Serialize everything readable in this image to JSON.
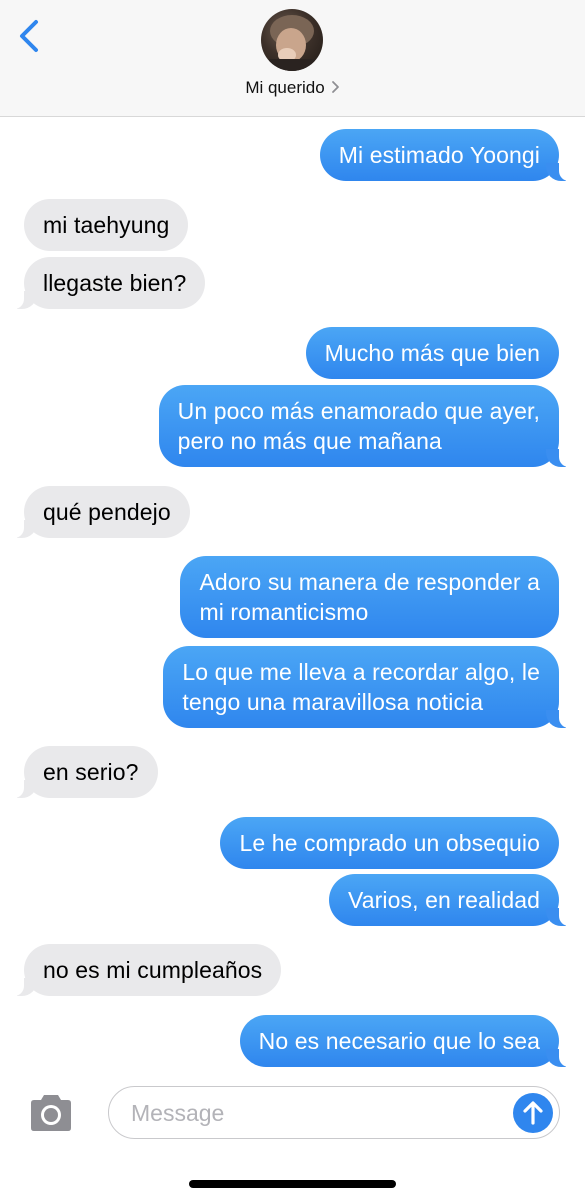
{
  "header": {
    "contact_name": "Mi querido",
    "icons": {
      "back": "chevron-left-icon",
      "name_chevron": "chevron-right-icon"
    }
  },
  "messages": [
    {
      "from": "me",
      "text": "Mi estimado Yoongi"
    },
    {
      "from": "them",
      "text": "mi taehyung"
    },
    {
      "from": "them",
      "text": "llegaste bien?"
    },
    {
      "from": "me",
      "text": "Mucho más que bien"
    },
    {
      "from": "me",
      "text": "Un poco más enamorado que ayer,\npero no más que mañana"
    },
    {
      "from": "them",
      "text": "qué pendejo"
    },
    {
      "from": "me",
      "text": "Adoro su manera de responder a\nmi romanticismo"
    },
    {
      "from": "me",
      "text": "Lo que me lleva a recordar algo, le\ntengo una maravillosa noticia"
    },
    {
      "from": "them",
      "text": "en serio?"
    },
    {
      "from": "me",
      "text": "Le he comprado un obsequio"
    },
    {
      "from": "me",
      "text": "Varios, en realidad"
    },
    {
      "from": "them",
      "text": "no es mi cumpleaños"
    },
    {
      "from": "me",
      "text": "No es necesario que lo sea"
    }
  ],
  "composer": {
    "placeholder": "Message",
    "value": "",
    "icons": {
      "camera": "camera-icon",
      "send": "arrow-up-icon"
    }
  },
  "colors": {
    "outgoing_bubble": "#3a8ef0",
    "incoming_bubble": "#e9e9eb",
    "accent": "#2f86ee"
  }
}
